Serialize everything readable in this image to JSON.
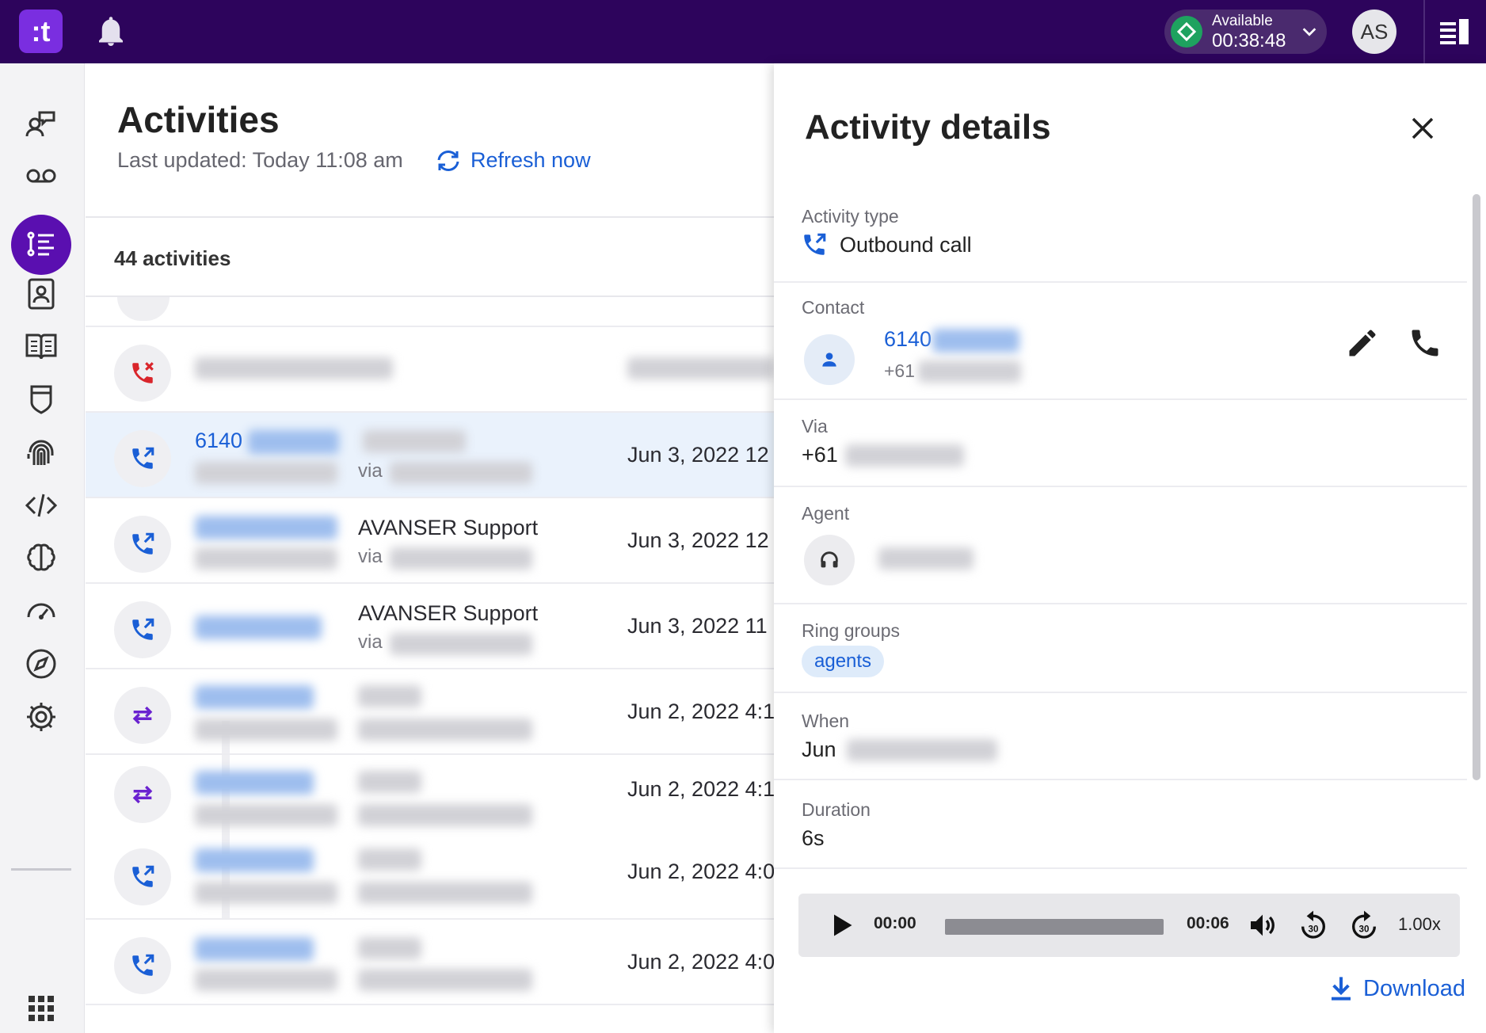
{
  "app": {
    "logo_text": ":t"
  },
  "topbar": {
    "status": {
      "label": "Available",
      "timer": "00:38:48"
    },
    "user_initials": "AS"
  },
  "sidebar": {
    "items": [
      {
        "icon": "conversation-icon"
      },
      {
        "icon": "voicemail-icon"
      },
      {
        "icon": "activities-list-icon",
        "active": true
      },
      {
        "icon": "contacts-icon"
      },
      {
        "icon": "book-icon"
      },
      {
        "icon": "shield-icon"
      },
      {
        "icon": "fingerprint-icon"
      },
      {
        "icon": "code-icon"
      },
      {
        "icon": "brain-icon"
      },
      {
        "icon": "speedometer-icon"
      },
      {
        "icon": "compass-icon"
      },
      {
        "icon": "gear-icon"
      },
      {
        "icon": "apps-grid-icon"
      }
    ]
  },
  "main": {
    "title": "Activities",
    "last_updated": "Last updated: Today 11:08 am",
    "refresh_label": "Refresh now",
    "count_label": "44 activities",
    "rows": [
      {
        "type": "missed-call",
        "primary": "",
        "name": "",
        "via": "",
        "date": ""
      },
      {
        "type": "outbound-call",
        "primary": "6140",
        "name": "",
        "via": "via",
        "date": "Jun 3, 2022 12",
        "selected": true
      },
      {
        "type": "outbound-call",
        "primary": "",
        "name": "AVANSER Support",
        "via": "via",
        "date": "Jun 3, 2022 12"
      },
      {
        "type": "outbound-call",
        "primary": "",
        "name": "AVANSER Support",
        "via": "via",
        "date": "Jun 3, 2022 11"
      },
      {
        "type": "transfer",
        "primary": "",
        "name": "",
        "via": "",
        "date": "Jun 2, 2022 4:1"
      },
      {
        "type": "transfer",
        "primary": "",
        "name": "",
        "via": "",
        "date": "Jun 2, 2022 4:1"
      },
      {
        "type": "outbound-call",
        "primary": "",
        "name": "",
        "via": "",
        "date": "Jun 2, 2022 4:0"
      },
      {
        "type": "outbound-call",
        "primary": "",
        "name": "",
        "via": "",
        "date": "Jun 2, 2022 4:0"
      }
    ]
  },
  "details": {
    "title": "Activity details",
    "activity_type": {
      "label": "Activity type",
      "value": "Outbound call"
    },
    "contact": {
      "label": "Contact",
      "name": "6140",
      "number": "+61"
    },
    "via": {
      "label": "Via",
      "value": "+61"
    },
    "agent": {
      "label": "Agent"
    },
    "ring_groups": {
      "label": "Ring groups",
      "chips": [
        "agents"
      ]
    },
    "when": {
      "label": "When",
      "value": "Jun"
    },
    "duration": {
      "label": "Duration",
      "value": "6s"
    },
    "player": {
      "current": "00:00",
      "total": "00:06",
      "speed": "1.00x",
      "progress": 0
    },
    "download_label": "Download"
  },
  "colors": {
    "topbar": "#2d045c",
    "accent": "#5a0fb0",
    "link": "#1a5fd6",
    "status_green": "#1ea25f"
  }
}
